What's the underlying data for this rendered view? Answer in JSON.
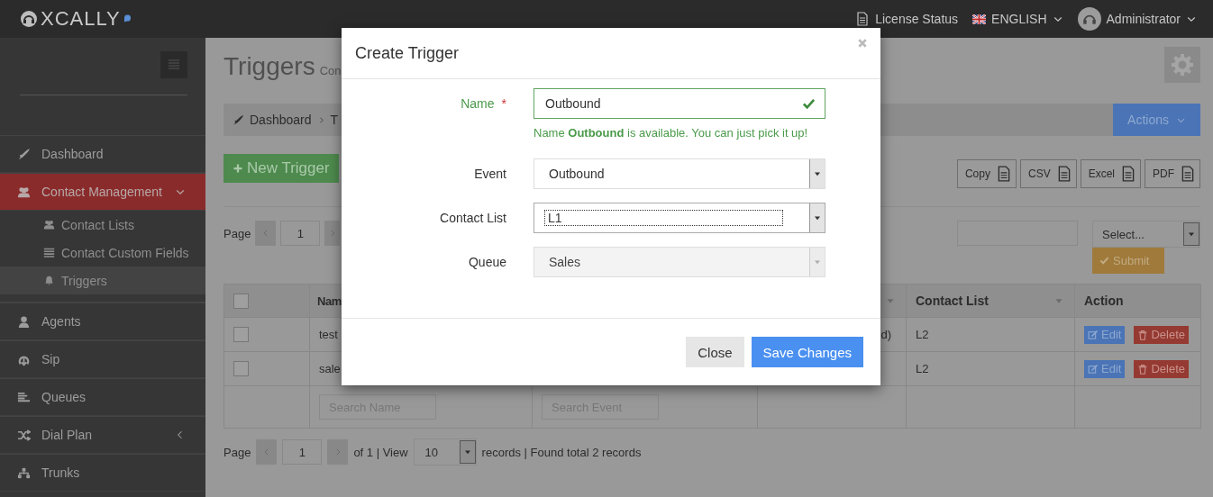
{
  "header": {
    "logo": "XCALLY",
    "license": "License Status",
    "language": "ENGLISH",
    "user": "Administrator"
  },
  "sidebar": {
    "items": [
      {
        "label": "Dashboard",
        "selected": false
      },
      {
        "label": "Contact Management",
        "selected": true,
        "expanded": true,
        "children": [
          {
            "label": "Contact Lists",
            "selected": false
          },
          {
            "label": "Contact Custom Fields",
            "selected": false
          },
          {
            "label": "Triggers",
            "selected": true
          }
        ]
      },
      {
        "label": "Agents",
        "selected": false
      },
      {
        "label": "Sip",
        "selected": false
      },
      {
        "label": "Queues",
        "selected": false
      },
      {
        "label": "Dial Plan",
        "selected": false,
        "expanded": false
      },
      {
        "label": "Trunks",
        "selected": false
      }
    ]
  },
  "page": {
    "title": "Triggers",
    "subtitle": "Con",
    "breadcrumb": [
      "Dashboard",
      "T"
    ],
    "actions_button": "Actions",
    "new_button": "New Trigger",
    "export_buttons": [
      "Copy",
      "CSV",
      "Excel",
      "PDF"
    ],
    "top_pager": {
      "label": "Page",
      "page": "1"
    },
    "filter": {
      "placeholder": "Select...",
      "submit": "Submit"
    },
    "table": {
      "columns": [
        {
          "kind": "checkbox",
          "checked": false
        },
        {
          "kind": "text",
          "label": "Nam"
        },
        {
          "kind": "blank"
        },
        {
          "kind": "sort"
        },
        {
          "kind": "text",
          "label": "Contact List"
        },
        {
          "kind": "text",
          "label": "Action"
        }
      ],
      "rows": [
        {
          "checked": false,
          "name": "test",
          "column_4": "d)",
          "contact_list": "L2",
          "actions": [
            "Edit",
            "Delete"
          ]
        },
        {
          "checked": false,
          "name": "sale",
          "contact_list": "L2",
          "actions": [
            "Edit",
            "Delete"
          ]
        }
      ],
      "search_placeholders": [
        "Search Name",
        "Search Event"
      ]
    },
    "bottom_pager": {
      "label": "Page",
      "page": "1",
      "of": "of 1 | View",
      "page_size": "10",
      "summary": "records | Found total 2 records"
    }
  },
  "modal": {
    "title": "Create Trigger",
    "fields": [
      {
        "kind": "text",
        "label": "Name",
        "required_mark": "*",
        "value": "Outbound",
        "valid": true,
        "help": "Name **Outbound** is available. You can just pick it up!"
      },
      {
        "kind": "select",
        "label": "Event",
        "value": "Outbound",
        "focused": false,
        "disabled": false
      },
      {
        "kind": "select",
        "label": "Contact List",
        "value": "L1",
        "focused": true,
        "disabled": false
      },
      {
        "kind": "select",
        "label": "Queue",
        "value": "Sales",
        "focused": false,
        "disabled": true
      }
    ],
    "buttons": [
      {
        "kind": "default",
        "label": "Close"
      },
      {
        "kind": "primary",
        "label": "Save Changes"
      }
    ]
  }
}
